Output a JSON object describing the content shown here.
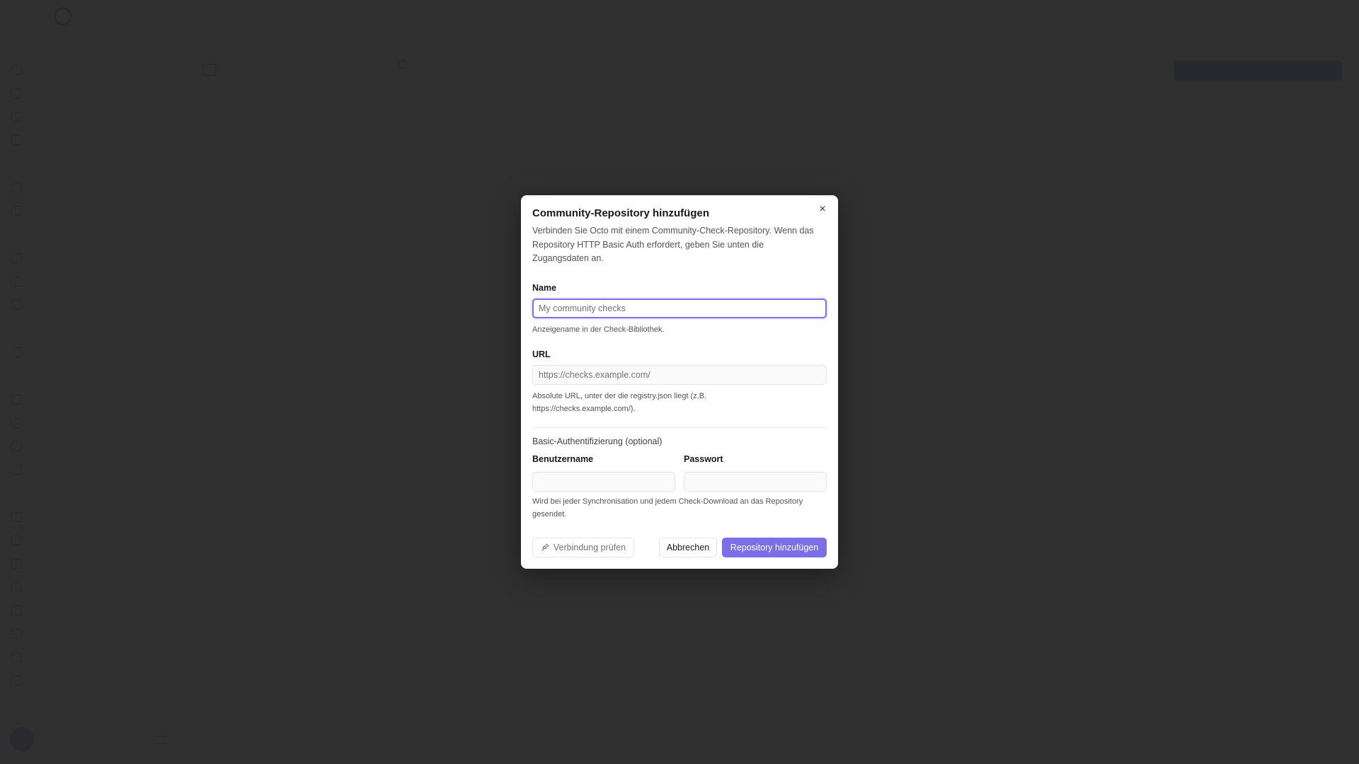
{
  "dialog": {
    "title": "Community-Repository hinzufügen",
    "description": "Verbinden Sie Octo mit einem Community-Check-Repository. Wenn das Repository HTTP Basic Auth erfordert, geben Sie unten die Zugangsdaten an.",
    "name_label": "Name",
    "name_placeholder": "My community checks",
    "name_value": "",
    "name_hint": "Anzeigename in der Check-Bibliothek.",
    "url_label": "URL",
    "url_placeholder": "https://checks.example.com/",
    "url_value": "",
    "url_hint": "Absolute URL, unter der die registry.json liegt (z.B. https://checks.example.com/).",
    "auth_section": "Basic-Authentifizierung (optional)",
    "username_label": "Benutzername",
    "username_value": "",
    "password_label": "Passwort",
    "password_value": "",
    "auth_hint": "Wird bei jeder Synchronisation und jedem Check-Download an das Repository gesendet.",
    "test_button": "Verbindung prüfen",
    "cancel_button": "Abbrechen",
    "submit_button": "Repository hinzufügen",
    "close_glyph": "×"
  },
  "colors": {
    "accent": "#7c6ee6",
    "overlay": "#282828"
  }
}
